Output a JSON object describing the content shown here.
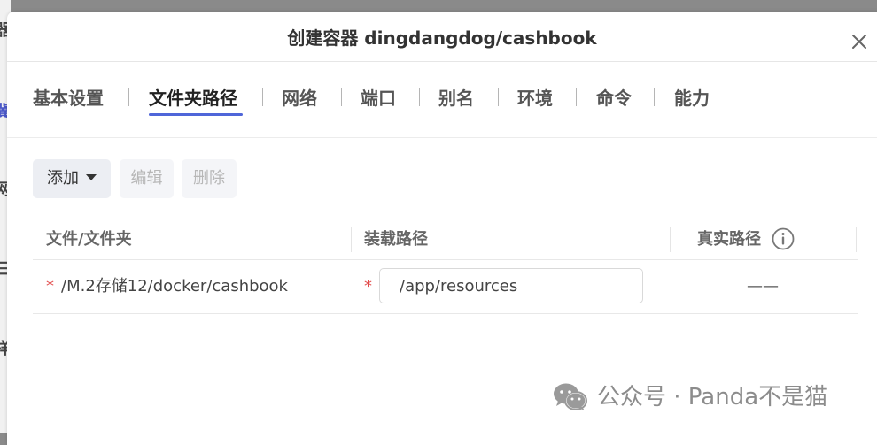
{
  "background": {
    "fragments": [
      "器",
      "冀",
      "网",
      "三",
      "样"
    ]
  },
  "dialog": {
    "title": "创建容器 dingdangdog/cashbook",
    "tabs": [
      {
        "label": "基本设置",
        "active": false
      },
      {
        "label": "文件夹路径",
        "active": true
      },
      {
        "label": "网络",
        "active": false
      },
      {
        "label": "端口",
        "active": false
      },
      {
        "label": "别名",
        "active": false
      },
      {
        "label": "环境",
        "active": false
      },
      {
        "label": "命令",
        "active": false
      },
      {
        "label": "能力",
        "active": false
      }
    ],
    "toolbar": {
      "add_label": "添加",
      "edit_label": "编辑",
      "delete_label": "删除"
    },
    "table": {
      "headers": [
        "文件/文件夹",
        "装载路径",
        "真实路径"
      ],
      "rows": [
        {
          "required_mark": "*",
          "file": "/M.2存储12/docker/cashbook",
          "mount_required_mark": "*",
          "mount_path": "/app/resources",
          "real_path": "——"
        }
      ]
    }
  },
  "watermark": {
    "text": "公众号 · Panda不是猫",
    "icon": "wechat-icon"
  },
  "colors": {
    "accent": "#4f66d9",
    "required": "#e24b4b",
    "disabled_text": "#b7b7b7"
  }
}
